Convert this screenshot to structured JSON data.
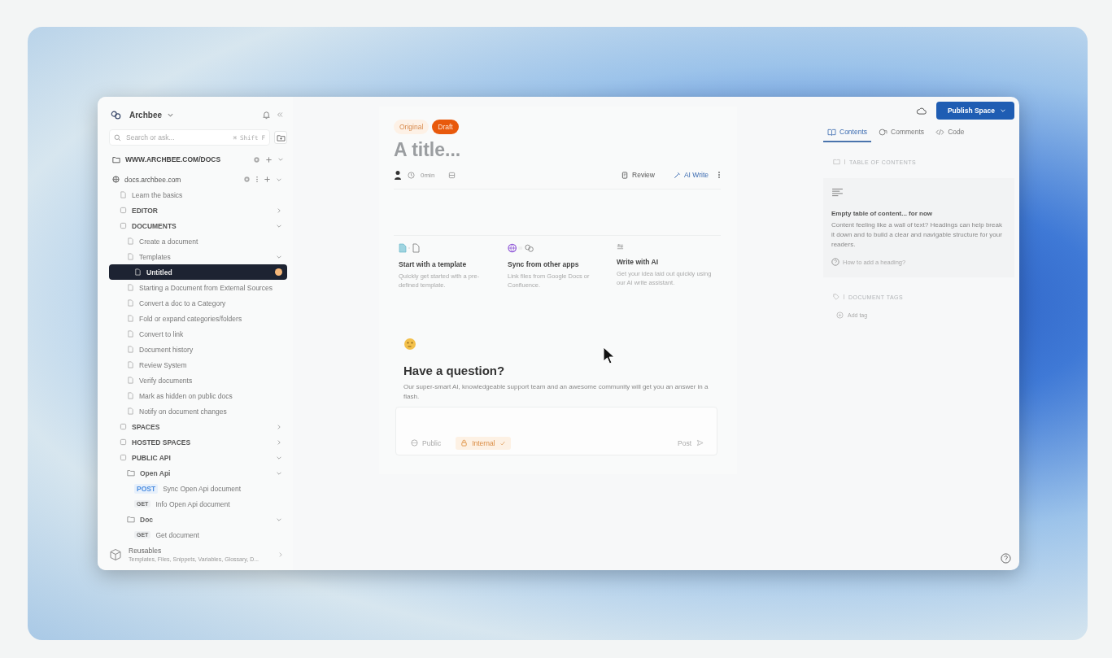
{
  "sidebar": {
    "workspace": "Archbee",
    "search": {
      "placeholder": "Search or ask...",
      "keys": [
        "⌘",
        "Shift",
        "F"
      ]
    },
    "space": {
      "label": "WWW.ARCHBEE.COM/DOCS",
      "expanded": true
    },
    "tree": [
      {
        "kind": "site",
        "label": "docs.archbee.com",
        "expanded": true,
        "selected": false,
        "draft": false,
        "children": [
          {
            "kind": "page",
            "label": "Learn the basics",
            "selected": false,
            "draft": false
          },
          {
            "kind": "category",
            "label": "EDITOR",
            "expanded": false,
            "selected": false,
            "draft": false
          },
          {
            "kind": "category",
            "label": "DOCUMENTS",
            "expanded": true,
            "selected": false,
            "draft": false,
            "children": [
              {
                "kind": "page",
                "label": "Create a document",
                "selected": false,
                "draft": false
              },
              {
                "kind": "page",
                "label": "Templates",
                "expanded": true,
                "selected": false,
                "draft": false,
                "children": [
                  {
                    "kind": "page",
                    "label": "Untitled",
                    "selected": true,
                    "draft": true
                  }
                ]
              },
              {
                "kind": "page",
                "label": "Starting a Document from External Sources",
                "selected": false,
                "draft": false
              },
              {
                "kind": "page",
                "label": "Convert a doc to a Category",
                "selected": false,
                "draft": false
              },
              {
                "kind": "page",
                "label": "Fold or expand categories/folders",
                "selected": false,
                "draft": false
              },
              {
                "kind": "page",
                "label": "Convert to link",
                "selected": false,
                "draft": false
              },
              {
                "kind": "page",
                "label": "Document history",
                "selected": false,
                "draft": false
              },
              {
                "kind": "page",
                "label": "Review System",
                "selected": false,
                "draft": false
              },
              {
                "kind": "page",
                "label": "Verify documents",
                "selected": false,
                "draft": false
              },
              {
                "kind": "page",
                "label": "Mark as hidden on public docs",
                "selected": false,
                "draft": false
              },
              {
                "kind": "page",
                "label": "Notify on document changes",
                "selected": false,
                "draft": false
              }
            ]
          },
          {
            "kind": "category",
            "label": "SPACES",
            "expanded": false,
            "selected": false,
            "draft": false
          },
          {
            "kind": "category",
            "label": "HOSTED SPACES",
            "expanded": false,
            "selected": false,
            "draft": false
          },
          {
            "kind": "category",
            "label": "PUBLIC API",
            "expanded": true,
            "selected": false,
            "draft": false,
            "children": [
              {
                "kind": "folder",
                "label": "Open Api",
                "expanded": true,
                "selected": false,
                "draft": false,
                "children": [
                  {
                    "kind": "endpoint",
                    "method": "POST",
                    "label": "Sync Open Api document",
                    "selected": false,
                    "draft": false
                  },
                  {
                    "kind": "endpoint",
                    "method": "GET",
                    "label": "Info Open Api document",
                    "selected": false,
                    "draft": false
                  }
                ]
              },
              {
                "kind": "folder",
                "label": "Doc",
                "expanded": true,
                "selected": false,
                "draft": false,
                "children": [
                  {
                    "kind": "endpoint",
                    "method": "GET",
                    "label": "Get document",
                    "selected": false,
                    "draft": false
                  }
                ]
              }
            ]
          }
        ]
      }
    ],
    "reusables": {
      "title": "Reusables",
      "subtitle": "Templates, Files, Snippets, Variables, Glossary, D..."
    }
  },
  "editor": {
    "versions": [
      {
        "label": "Original",
        "selected": false
      },
      {
        "label": "Draft",
        "selected": true
      }
    ],
    "title_placeholder": "A title...",
    "read_time": "0min",
    "actions": [
      {
        "kind": "review",
        "label": "Review"
      },
      {
        "kind": "ai",
        "label": "AI Write"
      }
    ],
    "cards": [
      {
        "kind": "template",
        "title": "Start with a template",
        "text": "Quickly get started with a pre-defined template."
      },
      {
        "kind": "sync",
        "title": "Sync from other apps",
        "text": "Link files from Google Docs or Confluence."
      },
      {
        "kind": "ai",
        "title": "Write with AI",
        "text": "Get your idea laid out quickly using our AI write assistant."
      }
    ],
    "question": {
      "heading": "Have a question?",
      "text": "Our super-smart AI, knowledgeable support team and an awesome community will get you an answer in a flash.",
      "visibility": [
        {
          "kind": "public",
          "label": "Public",
          "selected": false
        },
        {
          "kind": "internal",
          "label": "Internal",
          "selected": true
        }
      ],
      "post": "Post"
    }
  },
  "right_panel": {
    "publish": "Publish Space",
    "tabs": [
      {
        "kind": "contents",
        "label": "Contents",
        "selected": true
      },
      {
        "kind": "comments",
        "label": "Comments",
        "selected": false
      },
      {
        "kind": "code",
        "label": "Code",
        "selected": false
      }
    ],
    "toc_heading": "TABLE OF CONTENTS",
    "empty_title": "Empty table of content... for now",
    "empty_text": "Content feeling like a wall of text? Headings can help break it down and to build a clear and navigable structure for your readers.",
    "help_link": "How to add a heading?",
    "tags_heading": "DOCUMENT TAGS",
    "add_tag": "Add tag"
  }
}
